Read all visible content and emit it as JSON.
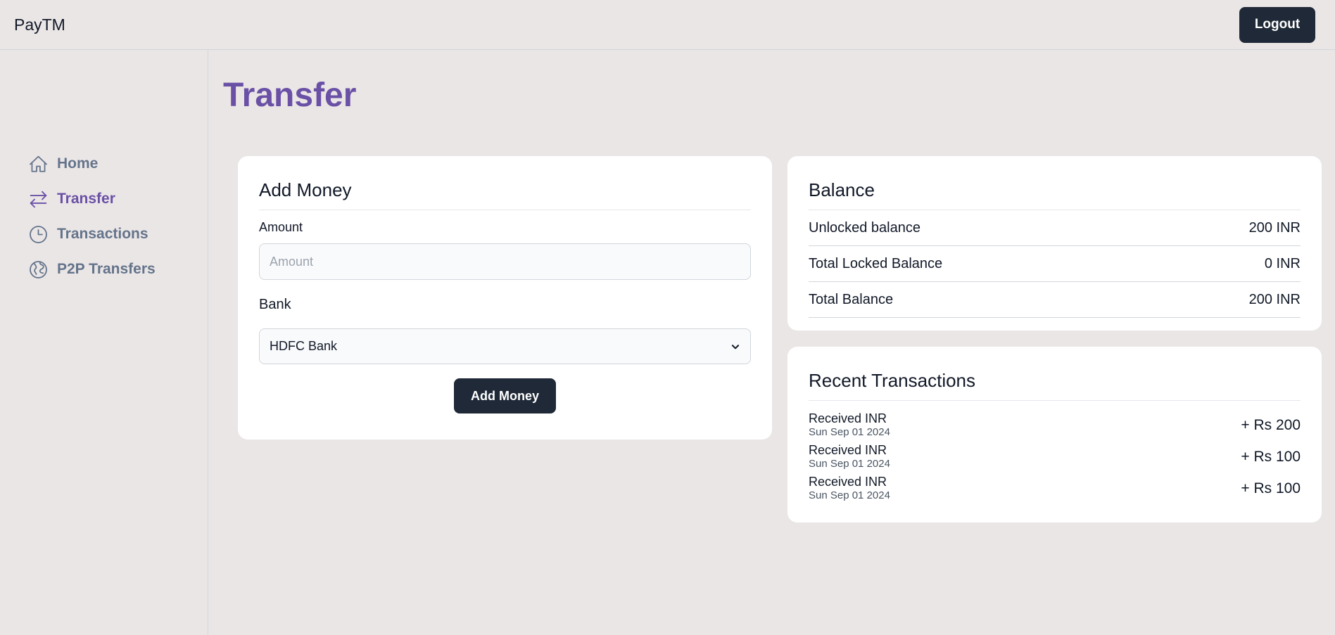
{
  "app": {
    "brand": "PayTM",
    "logout_label": "Logout"
  },
  "sidebar": {
    "items": [
      {
        "label": "Home",
        "icon": "home-icon",
        "active": false
      },
      {
        "label": "Transfer",
        "icon": "transfer-arrows-icon",
        "active": true
      },
      {
        "label": "Transactions",
        "icon": "clock-icon",
        "active": false
      },
      {
        "label": "P2P Transfers",
        "icon": "globe-icon",
        "active": false
      }
    ]
  },
  "page": {
    "title": "Transfer"
  },
  "add_money": {
    "title": "Add Money",
    "amount_label": "Amount",
    "amount_placeholder": "Amount",
    "amount_value": "",
    "bank_label": "Bank",
    "bank_selected": "HDFC Bank",
    "button_label": "Add Money"
  },
  "balance": {
    "title": "Balance",
    "rows": [
      {
        "label": "Unlocked balance",
        "value": "200 INR"
      },
      {
        "label": "Total Locked Balance",
        "value": "0 INR"
      },
      {
        "label": "Total Balance",
        "value": "200 INR"
      }
    ]
  },
  "recent_transactions": {
    "title": "Recent Transactions",
    "items": [
      {
        "label": "Received INR",
        "date": "Sun Sep 01 2024",
        "amount": "+ Rs 200"
      },
      {
        "label": "Received INR",
        "date": "Sun Sep 01 2024",
        "amount": "+ Rs 100"
      },
      {
        "label": "Received INR",
        "date": "Sun Sep 01 2024",
        "amount": "+ Rs 100"
      }
    ]
  },
  "colors": {
    "background": "#ebe6e6",
    "accent": "#6a51a6",
    "nav_inactive": "#64748b",
    "button_dark": "#1f2937"
  }
}
